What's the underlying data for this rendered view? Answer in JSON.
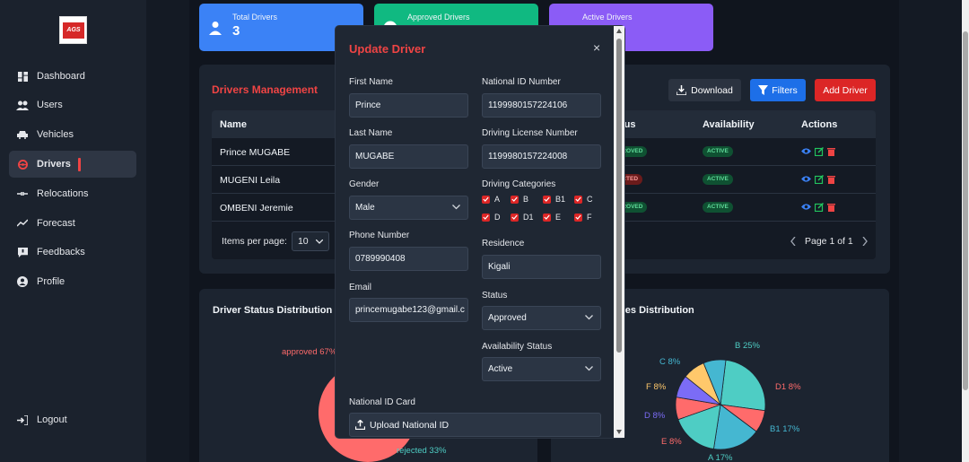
{
  "logo": {
    "text": "AGS"
  },
  "sidebar": {
    "items": [
      {
        "label": "Dashboard",
        "icon": "dashboard-icon"
      },
      {
        "label": "Users",
        "icon": "users-icon"
      },
      {
        "label": "Vehicles",
        "icon": "car-icon"
      },
      {
        "label": "Drivers",
        "icon": "driver-icon"
      },
      {
        "label": "Relocations",
        "icon": "relocation-icon"
      },
      {
        "label": "Forecast",
        "icon": "chart-icon"
      },
      {
        "label": "Feedbacks",
        "icon": "feedback-icon"
      },
      {
        "label": "Profile",
        "icon": "profile-icon"
      }
    ],
    "logout": "Logout"
  },
  "stats": [
    {
      "label": "Total Drivers",
      "value": "3",
      "color": "#3b82f6"
    },
    {
      "label": "Approved Drivers",
      "value": "",
      "color": "#10b981"
    },
    {
      "label": "Active Drivers",
      "value": "",
      "color": "#8b5cf6"
    }
  ],
  "management": {
    "title": "Drivers Management",
    "download": "Download",
    "filters": "Filters",
    "add": "Add Driver",
    "headers": {
      "name": "Name",
      "status": "tus",
      "availability": "Availability",
      "actions": "Actions"
    },
    "rows": [
      {
        "name": "Prince MUGABE",
        "status": "PROVED",
        "status_color": "green",
        "availability": "ACTIVE"
      },
      {
        "name": "MUGENI Leila",
        "status": "ECTED",
        "status_color": "red",
        "availability": "ACTIVE"
      },
      {
        "name": "OMBENI Jeremie",
        "status": "PROVED",
        "status_color": "green",
        "availability": "ACTIVE"
      }
    ],
    "items_per_page_label": "Items per page:",
    "items_per_page_value": "10",
    "page_label": "Page 1 of 1"
  },
  "status_chart": {
    "title": "Driver Status Distribution",
    "approved_label": "approved 67%",
    "rejected_label": "rejected 33%"
  },
  "categories_chart": {
    "title": "gories Distribution",
    "slices": [
      {
        "label": "B",
        "value": 25,
        "color": "#4ecdc4"
      },
      {
        "label": "D1",
        "value": 8,
        "color": "#ff6b6b"
      },
      {
        "label": "B1",
        "value": 17,
        "color": "#45b7d1"
      },
      {
        "label": "A",
        "value": 17,
        "color": "#4ecdc4"
      },
      {
        "label": "E",
        "value": 8,
        "color": "#ff6b6b"
      },
      {
        "label": "D",
        "value": 8,
        "color": "#7b6cf6"
      },
      {
        "label": "F",
        "value": 8,
        "color": "#ffc86b"
      },
      {
        "label": "C",
        "value": 8,
        "color": "#45b7d1"
      }
    ],
    "labels": {
      "b": "B 25%",
      "d1": "D1 8%",
      "b1": "B1 17%",
      "a": "A 17%",
      "e": "E 8%",
      "d": "D 8%",
      "f": "F 8%",
      "c": "C 8%"
    }
  },
  "modal": {
    "title": "Update Driver",
    "close": "×",
    "first_name_label": "First Name",
    "first_name": "Prince",
    "last_name_label": "Last Name",
    "last_name": "MUGABE",
    "gender_label": "Gender",
    "gender": "Male",
    "phone_label": "Phone Number",
    "phone": "0789990408",
    "email_label": "Email",
    "email": "princemugabe123@gmail.c",
    "national_id_label": "National ID Number",
    "national_id": "1199980157224106",
    "license_label": "Driving License Number",
    "license": "1199980157224008",
    "categories_label": "Driving Categories",
    "categories": [
      "A",
      "B",
      "B1",
      "C",
      "D",
      "D1",
      "E",
      "F"
    ],
    "residence_label": "Residence",
    "residence": "Kigali",
    "status_label": "Status",
    "status": "Approved",
    "availability_label": "Availability Status",
    "availability": "Active",
    "id_card_label": "National ID Card",
    "upload_label": "Upload National ID"
  }
}
